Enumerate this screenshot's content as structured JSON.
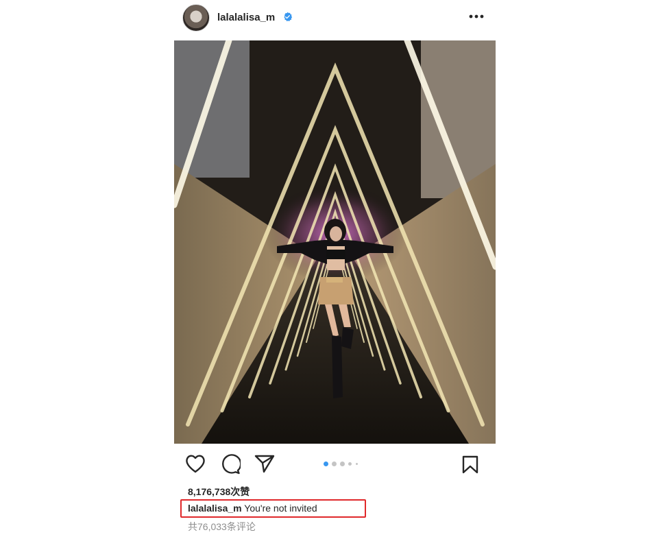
{
  "post": {
    "username": "lalalalisa_m",
    "verified": true,
    "more_icon": "more-horizontal-icon",
    "carousel": {
      "total": 5,
      "active_index": 0
    },
    "actions": {
      "like_icon": "heart-icon",
      "comment_icon": "comment-icon",
      "share_icon": "send-icon",
      "save_icon": "bookmark-icon"
    },
    "likes_text": "8,176,738次赞",
    "caption": {
      "username": "lalalalisa_m",
      "text": "You're not invited"
    },
    "comments_text": "共76,033条评论"
  },
  "colors": {
    "verified_blue": "#3897f0",
    "carousel_active": "#3897f0",
    "carousel_inactive": "#c4c4c4",
    "highlight_box": "#e0282a",
    "secondary_text": "#8e8e8e"
  }
}
